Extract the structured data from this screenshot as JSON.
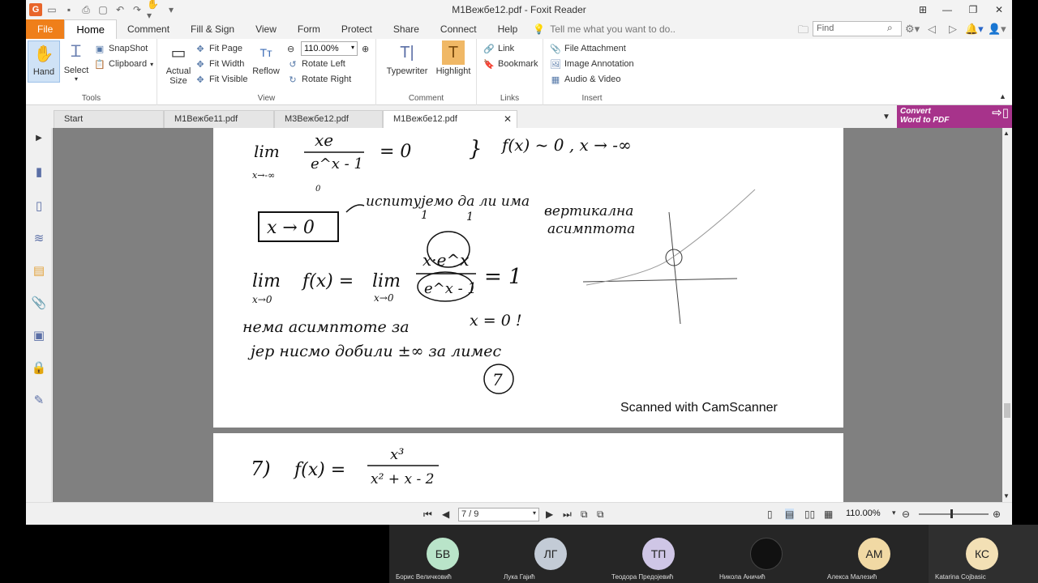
{
  "window": {
    "title": "M1Вежбе12.pdf - Foxit Reader"
  },
  "menu": {
    "tabs": [
      "File",
      "Home",
      "Comment",
      "Fill & Sign",
      "View",
      "Form",
      "Protect",
      "Share",
      "Connect",
      "Help"
    ],
    "tell_me": "Tell me what you want to do..",
    "find_placeholder": "Find"
  },
  "ribbon": {
    "tools": {
      "label": "Tools",
      "hand": "Hand",
      "select": "Select",
      "snapshot": "SnapShot",
      "clipboard": "Clipboard"
    },
    "view": {
      "label": "View",
      "actual_size_1": "Actual",
      "actual_size_2": "Size",
      "fit_page": "Fit Page",
      "fit_width": "Fit Width",
      "fit_visible": "Fit Visible",
      "reflow": "Reflow",
      "zoom": "110.00%",
      "rotate_left": "Rotate Left",
      "rotate_right": "Rotate Right"
    },
    "comment": {
      "label": "Comment",
      "typewriter": "Typewriter",
      "highlight": "Highlight"
    },
    "links": {
      "label": "Links",
      "link": "Link",
      "bookmark": "Bookmark"
    },
    "insert": {
      "label": "Insert",
      "file_attachment": "File Attachment",
      "image_annotation": "Image Annotation",
      "audio_video": "Audio & Video"
    }
  },
  "doc_tabs": [
    "Start",
    "M1Вежбе11.pdf",
    "M3Вежбе12.pdf",
    "M1Вежбе12.pdf"
  ],
  "convert_banner": {
    "line1": "Convert",
    "line2": "Word to PDF"
  },
  "document": {
    "watermark": "Scanned with CamScanner",
    "hw": {
      "lim1_num": "xe",
      "lim1_den": "e^x - 1",
      "lim1_label": "lim",
      "lim1_sub": "x→-∞",
      "eq0": "= 0",
      "f_asym": "f(x) ~ 0 ,   x → -∞",
      "zero_small": "0",
      "one_small": "1",
      "boxed": "x → 0",
      "note_ru": "испитујемо да ли има",
      "note_vert": "вертикална",
      "note_asim": "асимптота",
      "lim2_label": "lim",
      "lim2_sub": "x→0",
      "lim2_f": "f(x) =",
      "lim2_lim": "lim",
      "lim2_sub2": "x→0",
      "lim2_num": "x·e^x",
      "lim2_den": "e^x - 1",
      "eq1": "= 1",
      "line_nema": "нема асимптоте за",
      "x_eq0": "x = 0 !",
      "line_jer": "јер нисмо добили ±∞ за лимес",
      "page_num": "7",
      "p2_label": "7)",
      "p2_f": "f(x) =",
      "p2_num": "x³",
      "p2_den": "x² + x - 2"
    }
  },
  "status": {
    "page": "7 / 9",
    "zoom": "110.00%"
  },
  "participants": [
    {
      "initials": "БВ",
      "name": "Борис Величковић",
      "color": "#b9e4c9"
    },
    {
      "initials": "ЛГ",
      "name": "Лука Гајић",
      "color": "#c3cbd6"
    },
    {
      "initials": "ТП",
      "name": "Теодора Предојевић",
      "color": "#cfc6e6"
    },
    {
      "initials": "",
      "name": "Никола Аничић",
      "color": "#111111"
    },
    {
      "initials": "АМ",
      "name": "Алекса Малезић",
      "color": "#f1d9a4"
    },
    {
      "initials": "КС",
      "name": "Katarina Cojbasic",
      "color": "#f3e0b5"
    }
  ]
}
